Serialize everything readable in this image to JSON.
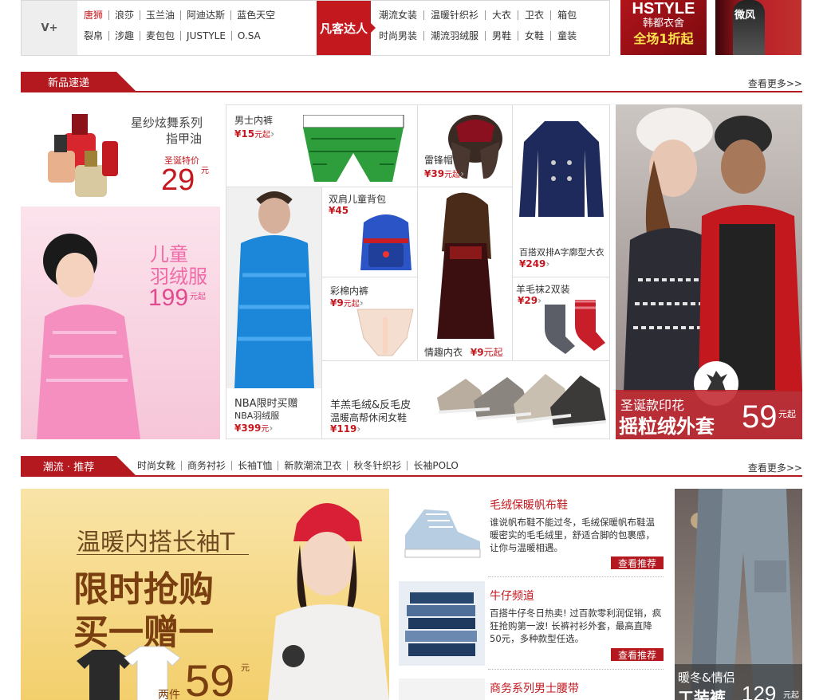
{
  "top": {
    "vplus": "V+",
    "brands_row1": [
      "唐狮",
      "浪莎",
      "玉兰油",
      "阿迪达斯",
      "蓝色天空"
    ],
    "brands_row2": [
      "裂帛",
      "涉趣",
      "麦包包",
      "JUSTYLE",
      "O.SA"
    ],
    "fanke": "凡客达人",
    "cats_row1": [
      "潮流女装",
      "温暖针织衫",
      "大衣",
      "卫衣",
      "箱包"
    ],
    "cats_row2": [
      "时尚男装",
      "潮流羽绒服",
      "男鞋",
      "女鞋",
      "童装"
    ],
    "ad1": {
      "l1": "HSTYLE",
      "l2": "韩都衣舍",
      "l3": "全场1折起"
    },
    "ad2": {
      "l1": "微风"
    }
  },
  "sec1": {
    "title": "新品速递",
    "more": "查看更多>>",
    "nail": {
      "name": "星纱炫舞系列",
      "name2": "指甲油",
      "tag": "圣诞特价",
      "price": "29",
      "unit": "元"
    },
    "kids": {
      "l1": "儿童",
      "l2": "羽绒服",
      "price": "199",
      "unit": "元起"
    },
    "underwear": {
      "name": "男士内裤",
      "price": "¥15",
      "suffix": "元起"
    },
    "hat": {
      "name": "雷锋帽",
      "price": "¥39",
      "suffix": "元起"
    },
    "coat": {
      "name": "百搭双排A字廓型大衣",
      "price": "¥249"
    },
    "jacket": {
      "name": "NBA限时买赠",
      "sub": "NBA羽绒服",
      "price": "¥399",
      "suffix": "元"
    },
    "backpack": {
      "name": "双肩儿童背包",
      "price": "¥45"
    },
    "lingerie": {
      "name": "情趣内衣",
      "price": "¥9",
      "suffix": "元起"
    },
    "cotton": {
      "name": "彩棉内裤",
      "price": "¥9",
      "suffix": "元起"
    },
    "socks": {
      "name": "羊毛袜2双装",
      "price": "¥29"
    },
    "shoes": {
      "name": "羊羔毛绒&反毛皮",
      "sub": "温暖高帮休闲女鞋",
      "price": "¥119"
    },
    "banner": {
      "l1": "圣诞款印花",
      "l2": "摇粒绒外套",
      "price": "59",
      "unit": "元起"
    }
  },
  "sec2": {
    "title": "潮流 · 推荐",
    "more": "查看更多>>",
    "links": [
      "时尚女靴",
      "商务衬衫",
      "长袖T恤",
      "新款潮流卫衣",
      "秋冬针织衫",
      "长袖POLO"
    ],
    "promo": {
      "l1": "温暖内搭长袖T",
      "l2": "限时抢购",
      "l3": "买一赠一",
      "price": "59",
      "unit": "元",
      "pre": "两件"
    },
    "items": [
      {
        "title": "毛绒保暖帆布鞋",
        "desc": "谁说帆布鞋不能过冬，毛绒保暖帆布鞋温暖密实的毛毛绒里，舒适合脚的包裹感，让你与温暖相遇。",
        "btn": "查看推荐"
      },
      {
        "title": "牛仔频道",
        "desc": "百搭牛仔冬日热卖! 过百款零利润促销，疯狂抢购第一波! 长裤衬衫外套，最高直降50元，多种款型任选。",
        "btn": "查看推荐"
      },
      {
        "title": "商务系列男士腰带"
      }
    ],
    "right": {
      "l1": "暖冬&情侣",
      "l2": "工装裤",
      "price": "129",
      "unit": "元起"
    }
  }
}
